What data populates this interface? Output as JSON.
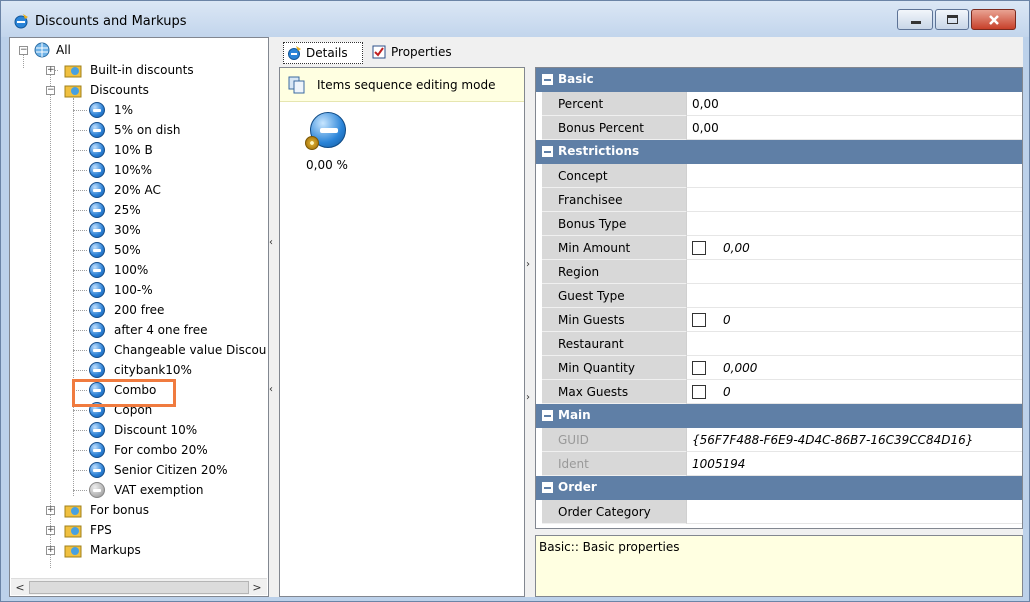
{
  "window": {
    "title": "Discounts and Markups"
  },
  "tree": {
    "root": "All",
    "groups": {
      "builtin": "Built-in discounts",
      "discounts": "Discounts",
      "forbonus": "For bonus",
      "fps": "FPS",
      "markups": "Markups"
    },
    "items": [
      "1%",
      "5% on dish",
      "10% B",
      "10%%",
      "20% AC",
      "25%",
      "30%",
      "50%",
      "100%",
      "100-%",
      "200 free",
      "after 4 one free",
      "Changeable value Discou",
      "citybank10%",
      "Combo",
      "Copon",
      "Discount 10%",
      "For combo 20%",
      "Senior Citizen 20%",
      "VAT exemption"
    ],
    "selected": "Combo"
  },
  "tabs": {
    "details": "Details",
    "properties": "Properties"
  },
  "middle": {
    "sequence_mode": "Items sequence editing mode",
    "value": "0,00 %"
  },
  "grid": {
    "basic": {
      "title": "Basic",
      "percent_label": "Percent",
      "percent_value": "0,00",
      "bonus_percent_label": "Bonus Percent",
      "bonus_percent_value": "0,00"
    },
    "restrictions": {
      "title": "Restrictions",
      "concept": "Concept",
      "franchisee": "Franchisee",
      "bonus_type": "Bonus Type",
      "min_amount": "Min Amount",
      "min_amount_value": "0,00",
      "region": "Region",
      "guest_type": "Guest Type",
      "min_guests": "Min Guests",
      "min_guests_value": "0",
      "restaurant": "Restaurant",
      "min_quantity": "Min Quantity",
      "min_quantity_value": "0,000",
      "max_guests": "Max Guests",
      "max_guests_value": "0"
    },
    "main": {
      "title": "Main",
      "guid": "GUID",
      "guid_value": "{56F7F488-F6E9-4D4C-86B7-16C39CC84D16}",
      "ident": "Ident",
      "ident_value": "1005194"
    },
    "order": {
      "title": "Order",
      "order_category": "Order Category"
    }
  },
  "description": "Basic:: Basic properties"
}
